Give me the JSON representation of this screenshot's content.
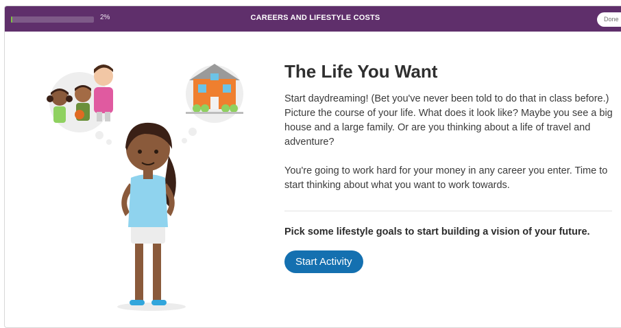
{
  "header": {
    "progress_percent": 2,
    "progress_label": "2%",
    "title": "CAREERS AND LIFESTYLE COSTS",
    "done_label": "Done"
  },
  "main": {
    "heading": "The Life You Want",
    "paragraph1": "Start daydreaming! (Bet you've never been told to do that in class before.) Picture the course of your life. What does it look like? Maybe you see a big house and a large family. Or are you thinking about a life of travel and adventure?",
    "paragraph2": "You're going to work hard for your money in any career you enter. Time to start thinking about what you want to work towards.",
    "prompt": "Pick some lifestyle goals to start building a vision of your future.",
    "start_button_label": "Start Activity"
  },
  "colors": {
    "header_bg": "#5f2f6b",
    "progress_fill": "#7fc242",
    "button_bg": "#1470b0"
  }
}
